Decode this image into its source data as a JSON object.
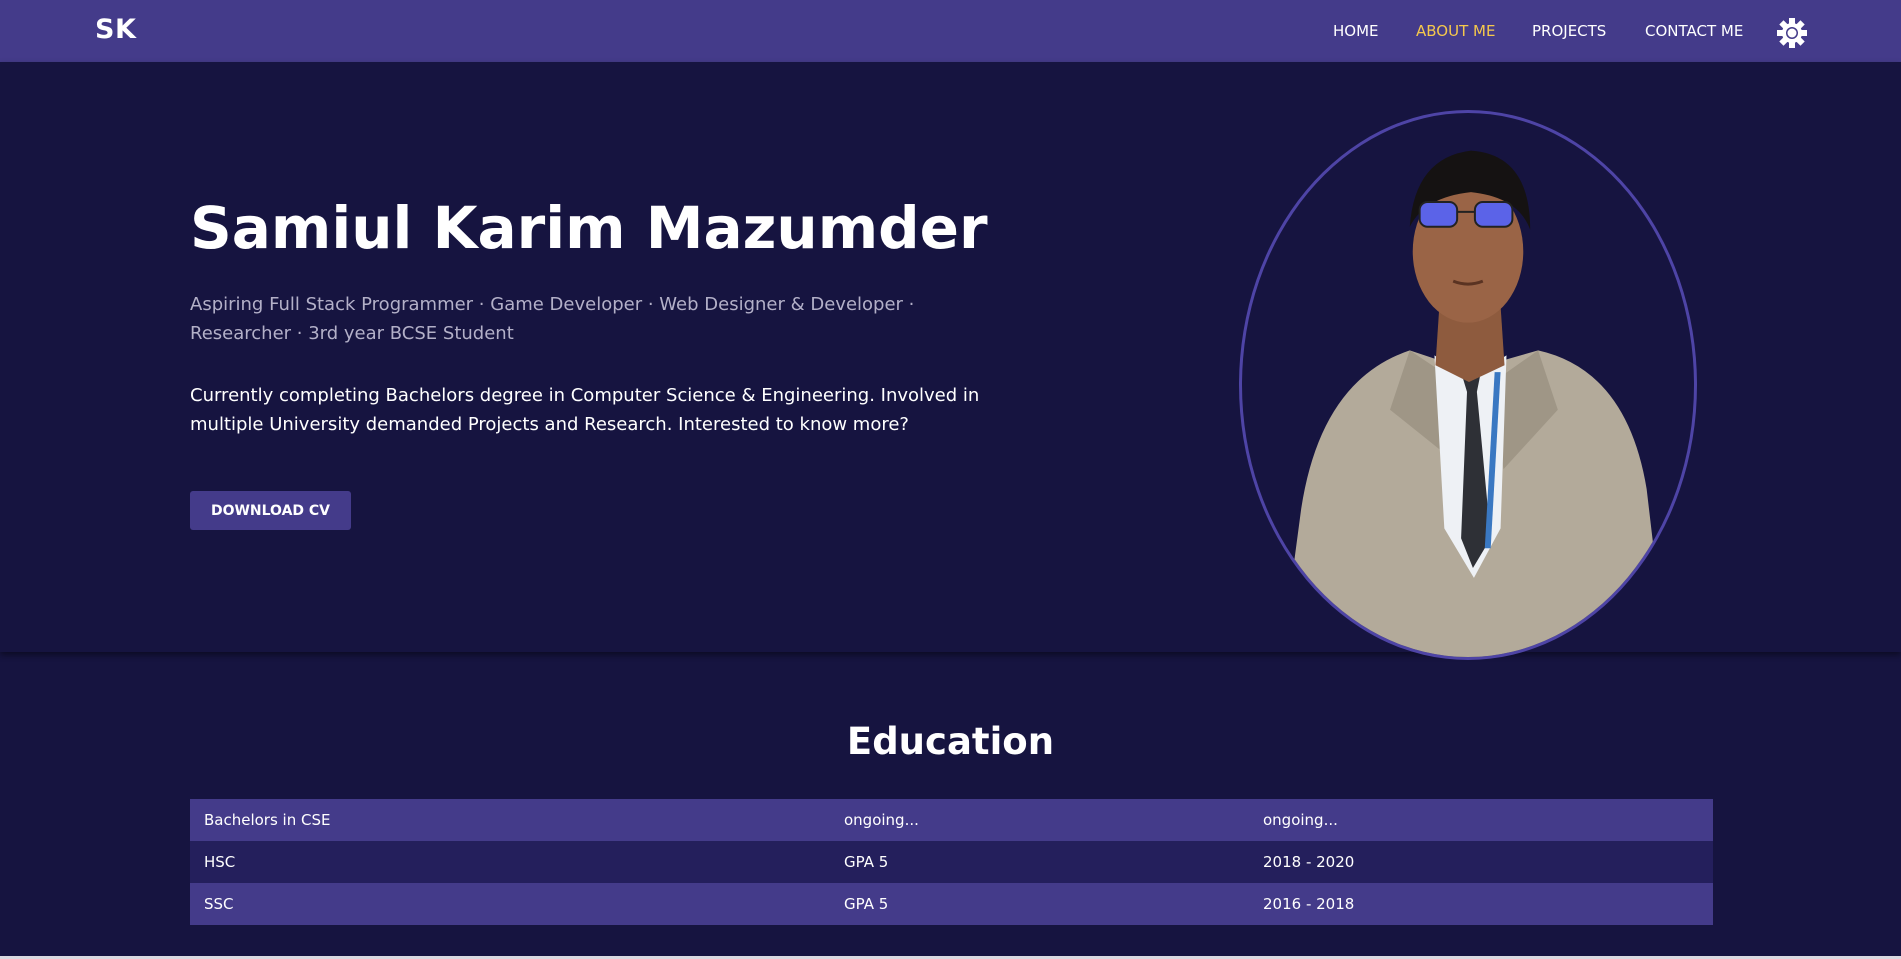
{
  "brand": {
    "logo": "SK"
  },
  "nav": {
    "items": [
      {
        "label": "HOME",
        "active": false
      },
      {
        "label": "ABOUT ME",
        "active": true
      },
      {
        "label": "PROJECTS",
        "active": false
      },
      {
        "label": "CONTACT ME",
        "active": false
      }
    ],
    "theme_toggle_icon": "sun-gear-icon"
  },
  "hero": {
    "name": "Samiul Karim Mazumder",
    "roles": "Aspiring Full Stack Programmer · Game Developer · Web Designer & Developer · Researcher · 3rd year BCSE Student",
    "description": "Currently completing Bachelors degree in Computer Science & Engineering. Involved in multiple University demanded Projects and Research. Interested to know more?",
    "cv_button": "DOWNLOAD CV"
  },
  "education": {
    "title": "Education",
    "rows": [
      {
        "degree": "Bachelors in CSE",
        "result": "ongoing...",
        "years": "ongoing..."
      },
      {
        "degree": "HSC",
        "result": "GPA 5",
        "years": "2018 - 2020"
      },
      {
        "degree": "SSC",
        "result": "GPA 5",
        "years": "2016 - 2018"
      }
    ]
  },
  "colors": {
    "navbar": "#443b8a",
    "background": "#161440",
    "accent_active": "#f5c84c",
    "table_row_odd": "#443b8a",
    "table_row_even": "#241f5c"
  }
}
